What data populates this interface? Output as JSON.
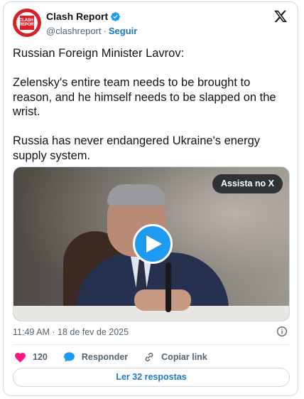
{
  "author": {
    "display_name": "Clash Report",
    "handle": "@clashreport",
    "separator": "·",
    "follow_label": "Seguir",
    "avatar_text": "CLASH REPORT"
  },
  "tweet": {
    "paragraphs": [
      "Russian Foreign Minister Lavrov:",
      "Zelensky's entire team needs to be brought to reason, and he himself needs to be slapped on the wrist.",
      "Russia has never endangered Ukraine's energy supply system."
    ]
  },
  "media": {
    "watch_label": "Assista no X"
  },
  "meta": {
    "timestamp": "11:49 AM · 18 de fev de 2025"
  },
  "actions": {
    "like_count": "120",
    "reply_label": "Responder",
    "copy_link_label": "Copiar link"
  },
  "read_replies_label": "Ler 32 respostas",
  "colors": {
    "accent": "#1d9bf0",
    "like": "#f91880",
    "link": "#1d78c4",
    "brand_red": "#d8202a"
  },
  "icons": {
    "platform": "x-logo-icon",
    "verified": "verified-badge-icon",
    "info": "info-icon",
    "like": "heart-icon",
    "reply": "speech-bubble-icon",
    "copy": "link-icon",
    "play": "play-icon"
  }
}
